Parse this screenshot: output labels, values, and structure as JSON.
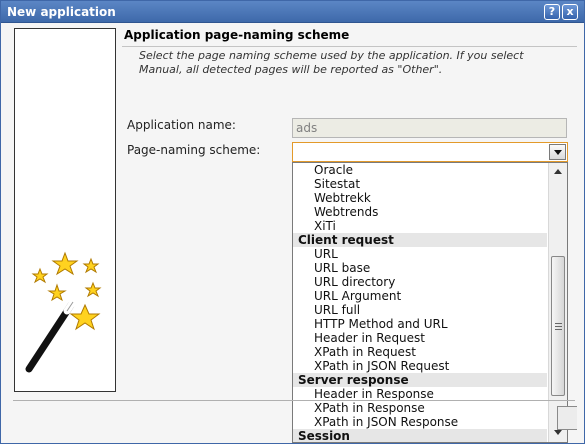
{
  "window": {
    "title": "New application",
    "help_label": "?",
    "close_label": "x"
  },
  "section": {
    "title": "Application page-naming scheme",
    "description": "Select the page naming scheme used by the application. If you select Manual, all detected pages will be reported as \"Other\"."
  },
  "form": {
    "app_name_label": "Application name:",
    "app_name_value": "ads",
    "scheme_label": "Page-naming scheme:",
    "scheme_value": ""
  },
  "dropdown": {
    "top_items": [
      "Oracle",
      "Sitestat",
      "Webtrekk",
      "Webtrends",
      "XiTi"
    ],
    "groups": [
      {
        "label": "Client request",
        "items": [
          "URL",
          "URL base",
          "URL directory",
          "URL Argument",
          "URL full",
          "HTTP Method and URL",
          "Header in Request",
          "XPath in Request",
          "XPath in JSON Request"
        ]
      },
      {
        "label": "Server response",
        "items": [
          "Header in Response",
          "XPath in Response",
          "XPath in JSON Response"
        ]
      },
      {
        "label": "Session",
        "items": []
      }
    ]
  },
  "colors": {
    "titlebar": "#3e69aa",
    "focus_border": "#e39a2a",
    "group_bg": "#e6e6e6"
  }
}
